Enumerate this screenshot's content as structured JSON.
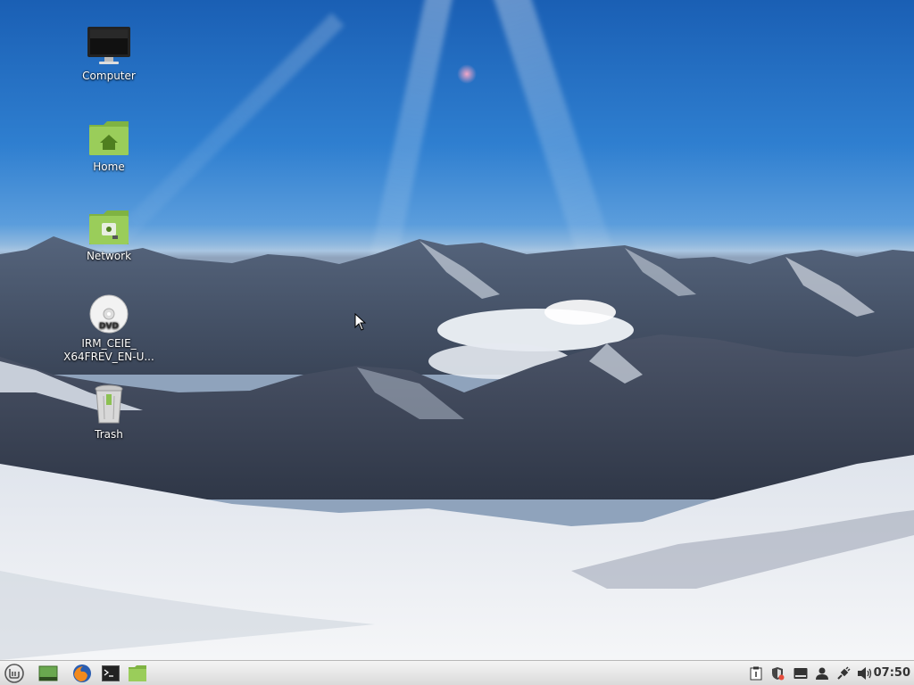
{
  "desktop": {
    "icons": [
      {
        "name": "computer",
        "label": "Computer"
      },
      {
        "name": "home",
        "label": "Home"
      },
      {
        "name": "network",
        "label": "Network"
      },
      {
        "name": "dvd",
        "label_line1": "IRM_CEIE_",
        "label_line2": "X64FREV_EN-U..."
      },
      {
        "name": "trash",
        "label": "Trash"
      }
    ],
    "wallpaper": "snowy-mountains"
  },
  "panel": {
    "menu_icon": "mint-menu-icon",
    "launchers": [
      "show-desktop-icon",
      "firefox-icon",
      "terminal-icon",
      "files-icon"
    ],
    "tray": [
      "clipboard-icon",
      "shield-icon",
      "keyboard-icon",
      "user-icon",
      "network-plug-icon",
      "volume-icon"
    ],
    "clock": "07:50"
  },
  "colors": {
    "sky_top": "#1a5fb4",
    "panel_bg": "#e6e6e6",
    "folder_green": "#8cc152"
  }
}
